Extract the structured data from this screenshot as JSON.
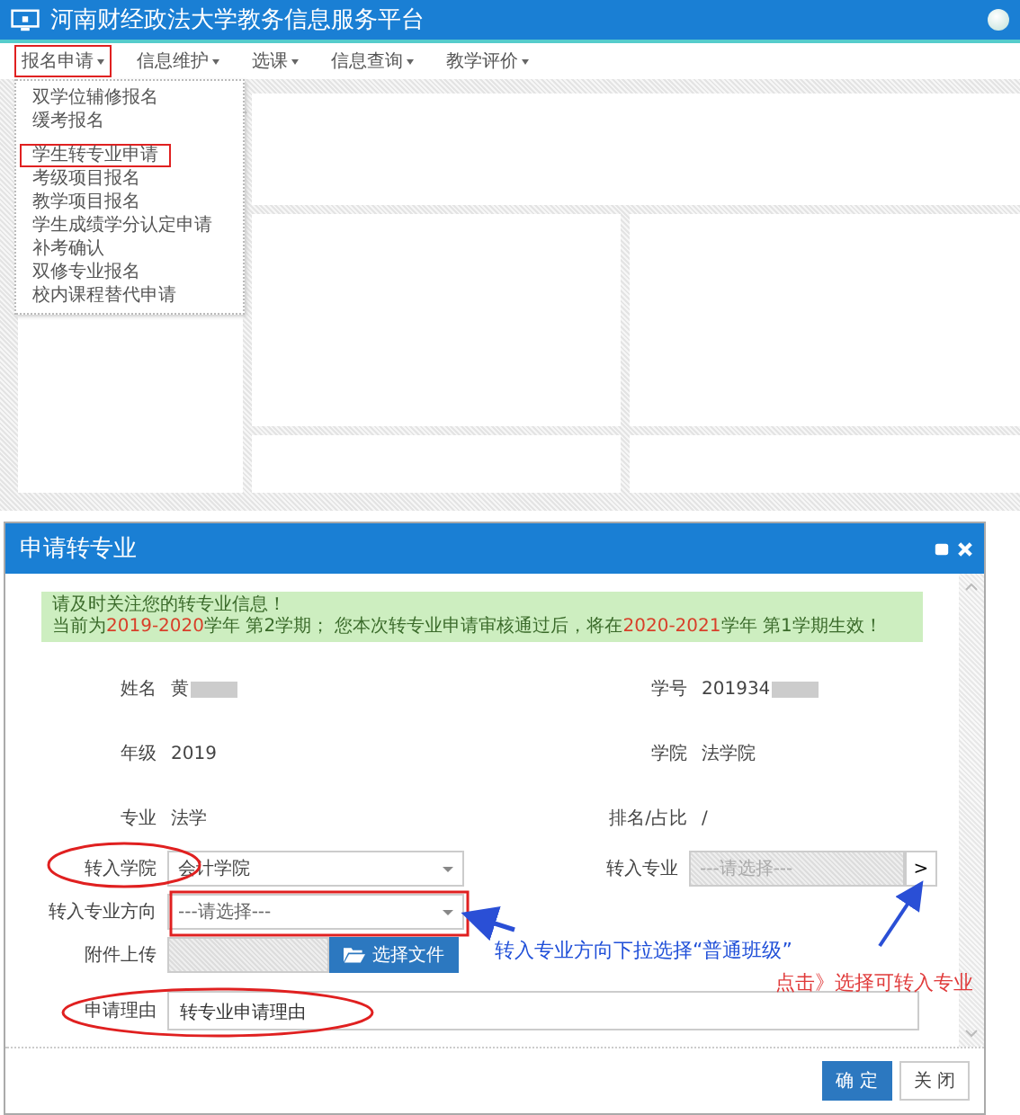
{
  "header": {
    "title": "河南财经政法大学教务信息服务平台"
  },
  "navbar": {
    "items": [
      {
        "label": "报名申请",
        "selected": true
      },
      {
        "label": "信息维护",
        "selected": false
      },
      {
        "label": "选课",
        "selected": false
      },
      {
        "label": "信息查询",
        "selected": false
      },
      {
        "label": "教学评价",
        "selected": false
      }
    ]
  },
  "dropdown": {
    "items": [
      {
        "label": "双学位辅修报名",
        "selected": false
      },
      {
        "label": "缓考报名",
        "selected": false
      },
      {
        "label": "学生转专业申请",
        "selected": true
      },
      {
        "label": "考级项目报名",
        "selected": false
      },
      {
        "label": "教学项目报名",
        "selected": false
      },
      {
        "label": "学生成绩学分认定申请",
        "selected": false
      },
      {
        "label": "补考确认",
        "selected": false
      },
      {
        "label": "双修专业报名",
        "selected": false
      },
      {
        "label": "校内课程替代申请",
        "selected": false
      }
    ]
  },
  "dialog": {
    "title": "申请转专业",
    "notice": {
      "line1": "请及时关注您的转专业信息！",
      "line2": [
        {
          "text": "当前为",
          "highlight": false
        },
        {
          "text": "2019-2020",
          "highlight": true
        },
        {
          "text": "学年 第2学期； 您本次转专业申请审核通过后，将在",
          "highlight": false
        },
        {
          "text": "2020-2021",
          "highlight": true
        },
        {
          "text": "学年 第1学期生效！",
          "highlight": false
        }
      ]
    },
    "info": [
      {
        "label": "姓名",
        "value": "黄",
        "redacted": true
      },
      {
        "label": "学号",
        "value": "201934",
        "redacted": true
      },
      {
        "label": "年级",
        "value": "2019",
        "redacted": false
      },
      {
        "label": "学院",
        "value": "法学院",
        "redacted": false
      },
      {
        "label": "专业",
        "value": "法学",
        "redacted": false
      },
      {
        "label": "排名/占比",
        "value": "/",
        "redacted": false
      }
    ],
    "form": [
      {
        "kind": "select",
        "label": "转入学院",
        "value": "会计学院",
        "disabled": false
      },
      {
        "kind": "picker",
        "label": "转入专业",
        "placeholder": "---请选择---",
        "button": ">",
        "disabled": true
      },
      {
        "kind": "select",
        "label": "转入专业方向",
        "placeholder": "---请选择---",
        "disabled": false
      },
      {
        "kind": "file",
        "label": "附件上传",
        "button": "选择文件"
      },
      {
        "kind": "textarea",
        "label": "申请理由",
        "value": "转专业申请理由"
      }
    ],
    "buttons": [
      {
        "label": "确 定",
        "kind": "primary"
      },
      {
        "label": "关 闭",
        "kind": "default"
      }
    ]
  },
  "annotations": [
    {
      "text": "转入专业方向下拉选择“普通班级”",
      "color": "#1f4fd8"
    },
    {
      "text": "点击》选择可转入专业",
      "color": "#e03a3a"
    }
  ]
}
